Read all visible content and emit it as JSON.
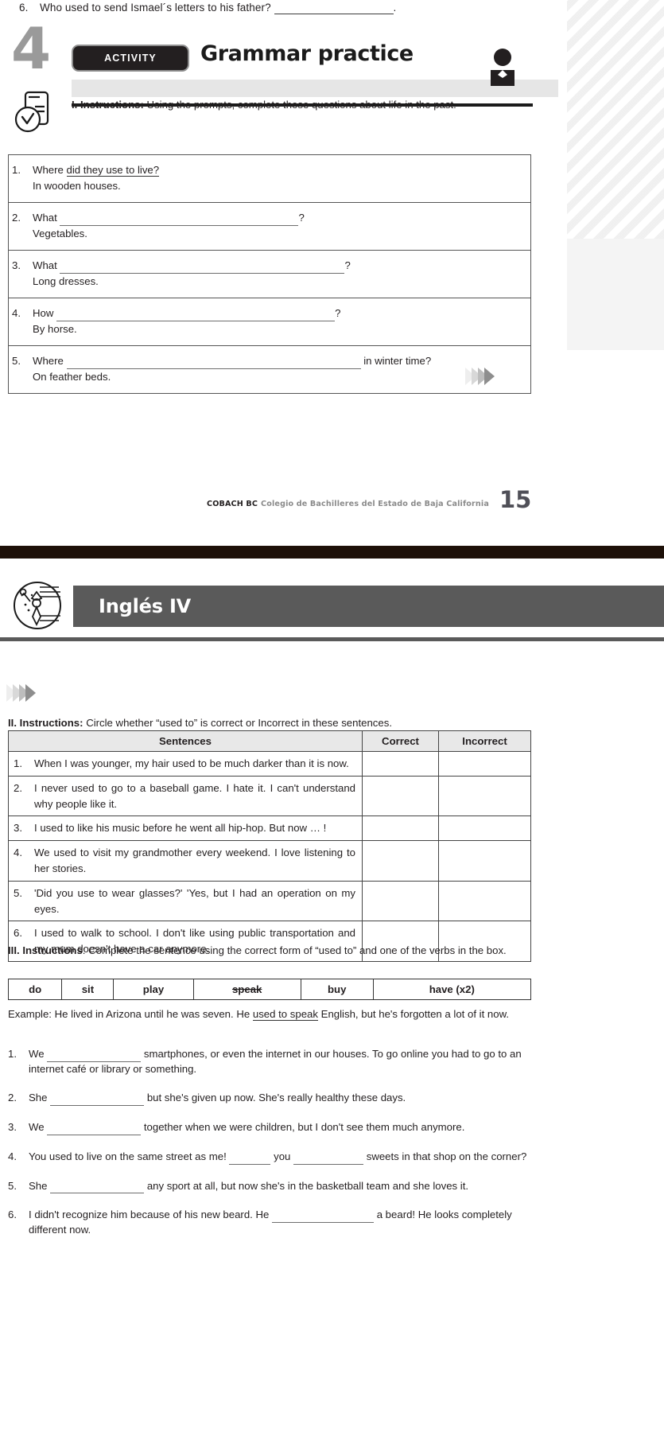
{
  "page1": {
    "carryover_question": {
      "number": "6.",
      "text": "Who used to send Ismael´s letters to his father?",
      "trailing": "."
    },
    "activity": {
      "number": "4",
      "badge_label": "ACTIVITY",
      "title": "Grammar practice",
      "reader_icon": "person-reading-icon",
      "clipboard_icon": "clipboard-check-icon"
    },
    "instruction_1": {
      "label": "I. Instructions:",
      "text": "Using the prompts, complete these questions about life in the past."
    },
    "exercise_1": {
      "items": [
        {
          "number": "1.",
          "prompt": "Where",
          "answer_given": "did they use to live?",
          "blank": false,
          "tail": "",
          "response": "In wooden houses."
        },
        {
          "number": "2.",
          "prompt": "What",
          "answer_given": "",
          "blank": true,
          "blank_width": 300,
          "tail": "?",
          "response": "Vegetables."
        },
        {
          "number": "3.",
          "prompt": "What",
          "answer_given": "",
          "blank": true,
          "blank_width": 358,
          "tail": "?",
          "response": "Long dresses."
        },
        {
          "number": "4.",
          "prompt": "How",
          "answer_given": "",
          "blank": true,
          "blank_width": 350,
          "tail": "?",
          "response": "By horse."
        },
        {
          "number": "5.",
          "prompt": "Where",
          "answer_given": "",
          "blank": true,
          "blank_width": 370,
          "tail": "in winter time?",
          "response": "On feather beds."
        }
      ]
    },
    "ornament": "chevron-arrows-icon",
    "footer": {
      "brand": "COBACH BC",
      "institution": "Colegio de Bachilleres del Estado de Baja California",
      "page_number": "15"
    }
  },
  "page2": {
    "header": {
      "logo_icon": "statue-of-liberty-icon",
      "title": "Inglés IV"
    },
    "ornament": "chevron-arrows-icon",
    "instruction_2": {
      "label": "II. Instructions:",
      "text": "Circle whether “used to” is correct or Incorrect in these sentences."
    },
    "exercise_2": {
      "columns": [
        "Sentences",
        "Correct",
        "Incorrect"
      ],
      "rows": [
        {
          "number": "1.",
          "sentence": "When I was younger, my hair used to be much darker than it is now."
        },
        {
          "number": "2.",
          "sentence": "I never used to go to a baseball game. I hate it. I can't understand why people like it."
        },
        {
          "number": "3.",
          "sentence": "I used to like his music before he went all hip-hop. But now … !"
        },
        {
          "number": "4.",
          "sentence": "We used to visit my grandmother every weekend. I love listening to her stories."
        },
        {
          "number": "5.",
          "sentence": "'Did you use to wear glasses?' 'Yes, but I had an operation on my eyes."
        },
        {
          "number": "6.",
          "sentence": "I used to walk to school. I don't like using public transportation and my mum doesn't have a car anymore."
        }
      ]
    },
    "instruction_3": {
      "label": "III. Instructions",
      "text": ": Complete the sentence using the correct form of “used to” and one of the verbs in the box."
    },
    "word_box": [
      {
        "word": "do",
        "struck": false
      },
      {
        "word": "sit",
        "struck": false
      },
      {
        "word": "play",
        "struck": false
      },
      {
        "word": "speak",
        "struck": true
      },
      {
        "word": "buy",
        "struck": false
      },
      {
        "word": "have (x2)",
        "struck": false
      }
    ],
    "example": {
      "prefix": "Example: He lived in Arizona until he was seven. He ",
      "filled": "used to speak",
      "suffix": " English, but he's forgotten a lot of it now."
    },
    "exercise_3": [
      {
        "number": "1.",
        "part_a": "We",
        "part_b": "smartphones, or even the internet in our houses. To go online you had to go to an internet café or library or something.",
        "second_blank": ""
      },
      {
        "number": "2.",
        "part_a": "She",
        "part_b": "but she's given up now. She's really healthy these days.",
        "second_blank": ""
      },
      {
        "number": "3.",
        "part_a": "We",
        "part_b": "together when we were children, but I don't see them much anymore.",
        "second_blank": ""
      },
      {
        "number": "4.",
        "part_a": "You used to live on the same street as me!",
        "part_b": "you",
        "second_blank": "sweets in that shop on the corner?"
      },
      {
        "number": "5.",
        "part_a": "She",
        "part_b": "any sport at all, but now she's in the basketball team and she loves it.",
        "second_blank": ""
      },
      {
        "number": "6.",
        "part_a": "I didn't recognize him because of his new beard. He",
        "part_b": "a beard! He looks completely different now.",
        "second_blank": ""
      }
    ]
  }
}
